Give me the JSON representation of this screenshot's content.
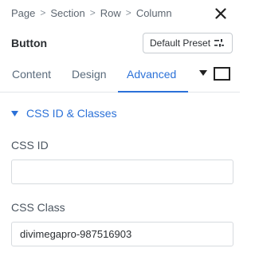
{
  "breadcrumb": {
    "items": [
      "Page",
      "Section",
      "Row",
      "Column"
    ],
    "separator": ">"
  },
  "header": {
    "title": "Button",
    "preset_label": "Default Preset",
    "close_icon": "close-icon"
  },
  "tabs": [
    {
      "label": "Content",
      "active": false
    },
    {
      "label": "Design",
      "active": false
    },
    {
      "label": "Advanced",
      "active": true
    }
  ],
  "section": {
    "title": "CSS ID & Classes",
    "expanded": true
  },
  "fields": {
    "css_id": {
      "label": "CSS ID",
      "value": ""
    },
    "css_class": {
      "label": "CSS Class",
      "value": "divimegapro-987516903"
    }
  },
  "colors": {
    "accent": "#2b71d8",
    "text": "#2b2f33",
    "muted": "#5a6b7c",
    "border": "#d7dbdf"
  }
}
